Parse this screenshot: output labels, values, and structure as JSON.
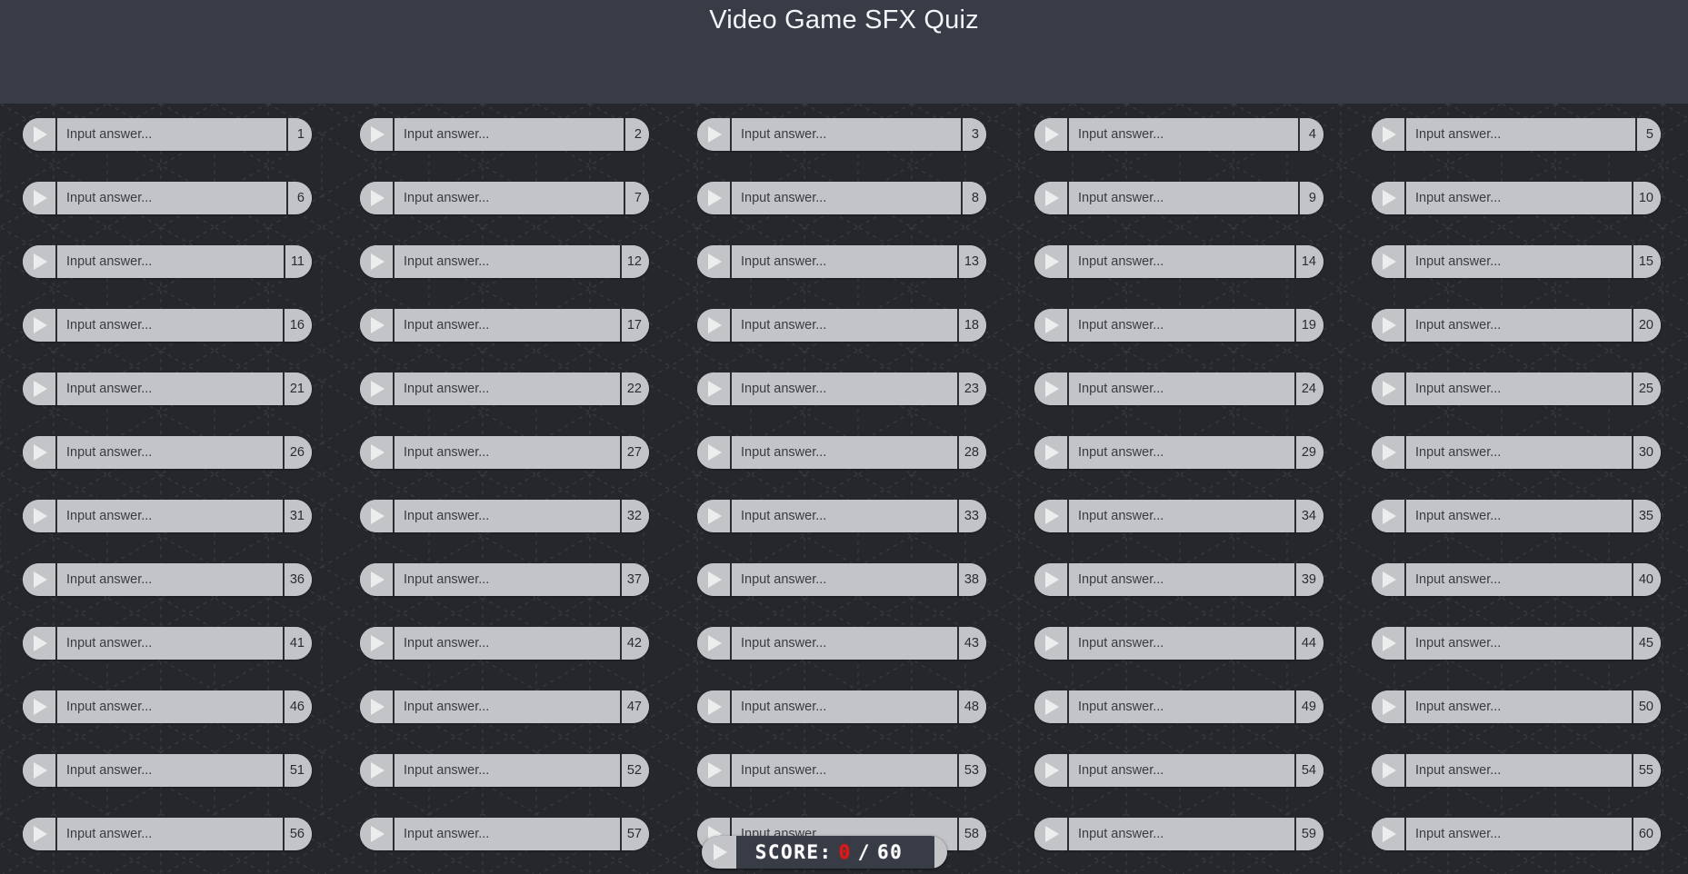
{
  "header": {
    "title": "Video Game SFX Quiz",
    "background_color": "#383c46",
    "title_color": "#f2f4f7"
  },
  "theme": {
    "page_background": "#26272c",
    "pill_background": "#c3c4c7",
    "pill_text": "#1b1c20",
    "divider": "#2c2d31",
    "score_panel_background": "#383c46",
    "score_text": "#ffffff",
    "score_value_color": "#e01818"
  },
  "grid": {
    "columns": 5,
    "rows": 12,
    "total_items": 60,
    "input_placeholder": "Input answer...",
    "play_icon": "play-icon",
    "items": [
      {
        "number": "1"
      },
      {
        "number": "2"
      },
      {
        "number": "3"
      },
      {
        "number": "4"
      },
      {
        "number": "5"
      },
      {
        "number": "6"
      },
      {
        "number": "7"
      },
      {
        "number": "8"
      },
      {
        "number": "9"
      },
      {
        "number": "10"
      },
      {
        "number": "11"
      },
      {
        "number": "12"
      },
      {
        "number": "13"
      },
      {
        "number": "14"
      },
      {
        "number": "15"
      },
      {
        "number": "16"
      },
      {
        "number": "17"
      },
      {
        "number": "18"
      },
      {
        "number": "19"
      },
      {
        "number": "20"
      },
      {
        "number": "21"
      },
      {
        "number": "22"
      },
      {
        "number": "23"
      },
      {
        "number": "24"
      },
      {
        "number": "25"
      },
      {
        "number": "26"
      },
      {
        "number": "27"
      },
      {
        "number": "28"
      },
      {
        "number": "29"
      },
      {
        "number": "30"
      },
      {
        "number": "31"
      },
      {
        "number": "32"
      },
      {
        "number": "33"
      },
      {
        "number": "34"
      },
      {
        "number": "35"
      },
      {
        "number": "36"
      },
      {
        "number": "37"
      },
      {
        "number": "38"
      },
      {
        "number": "39"
      },
      {
        "number": "40"
      },
      {
        "number": "41"
      },
      {
        "number": "42"
      },
      {
        "number": "43"
      },
      {
        "number": "44"
      },
      {
        "number": "45"
      },
      {
        "number": "46"
      },
      {
        "number": "47"
      },
      {
        "number": "48"
      },
      {
        "number": "49"
      },
      {
        "number": "50"
      },
      {
        "number": "51"
      },
      {
        "number": "52"
      },
      {
        "number": "53"
      },
      {
        "number": "54"
      },
      {
        "number": "55"
      },
      {
        "number": "56"
      },
      {
        "number": "57"
      },
      {
        "number": "58"
      },
      {
        "number": "59"
      },
      {
        "number": "60"
      }
    ]
  },
  "score": {
    "label": "SCORE:",
    "value": "0",
    "separator": "/",
    "total": "60",
    "play_icon": "play-icon"
  }
}
